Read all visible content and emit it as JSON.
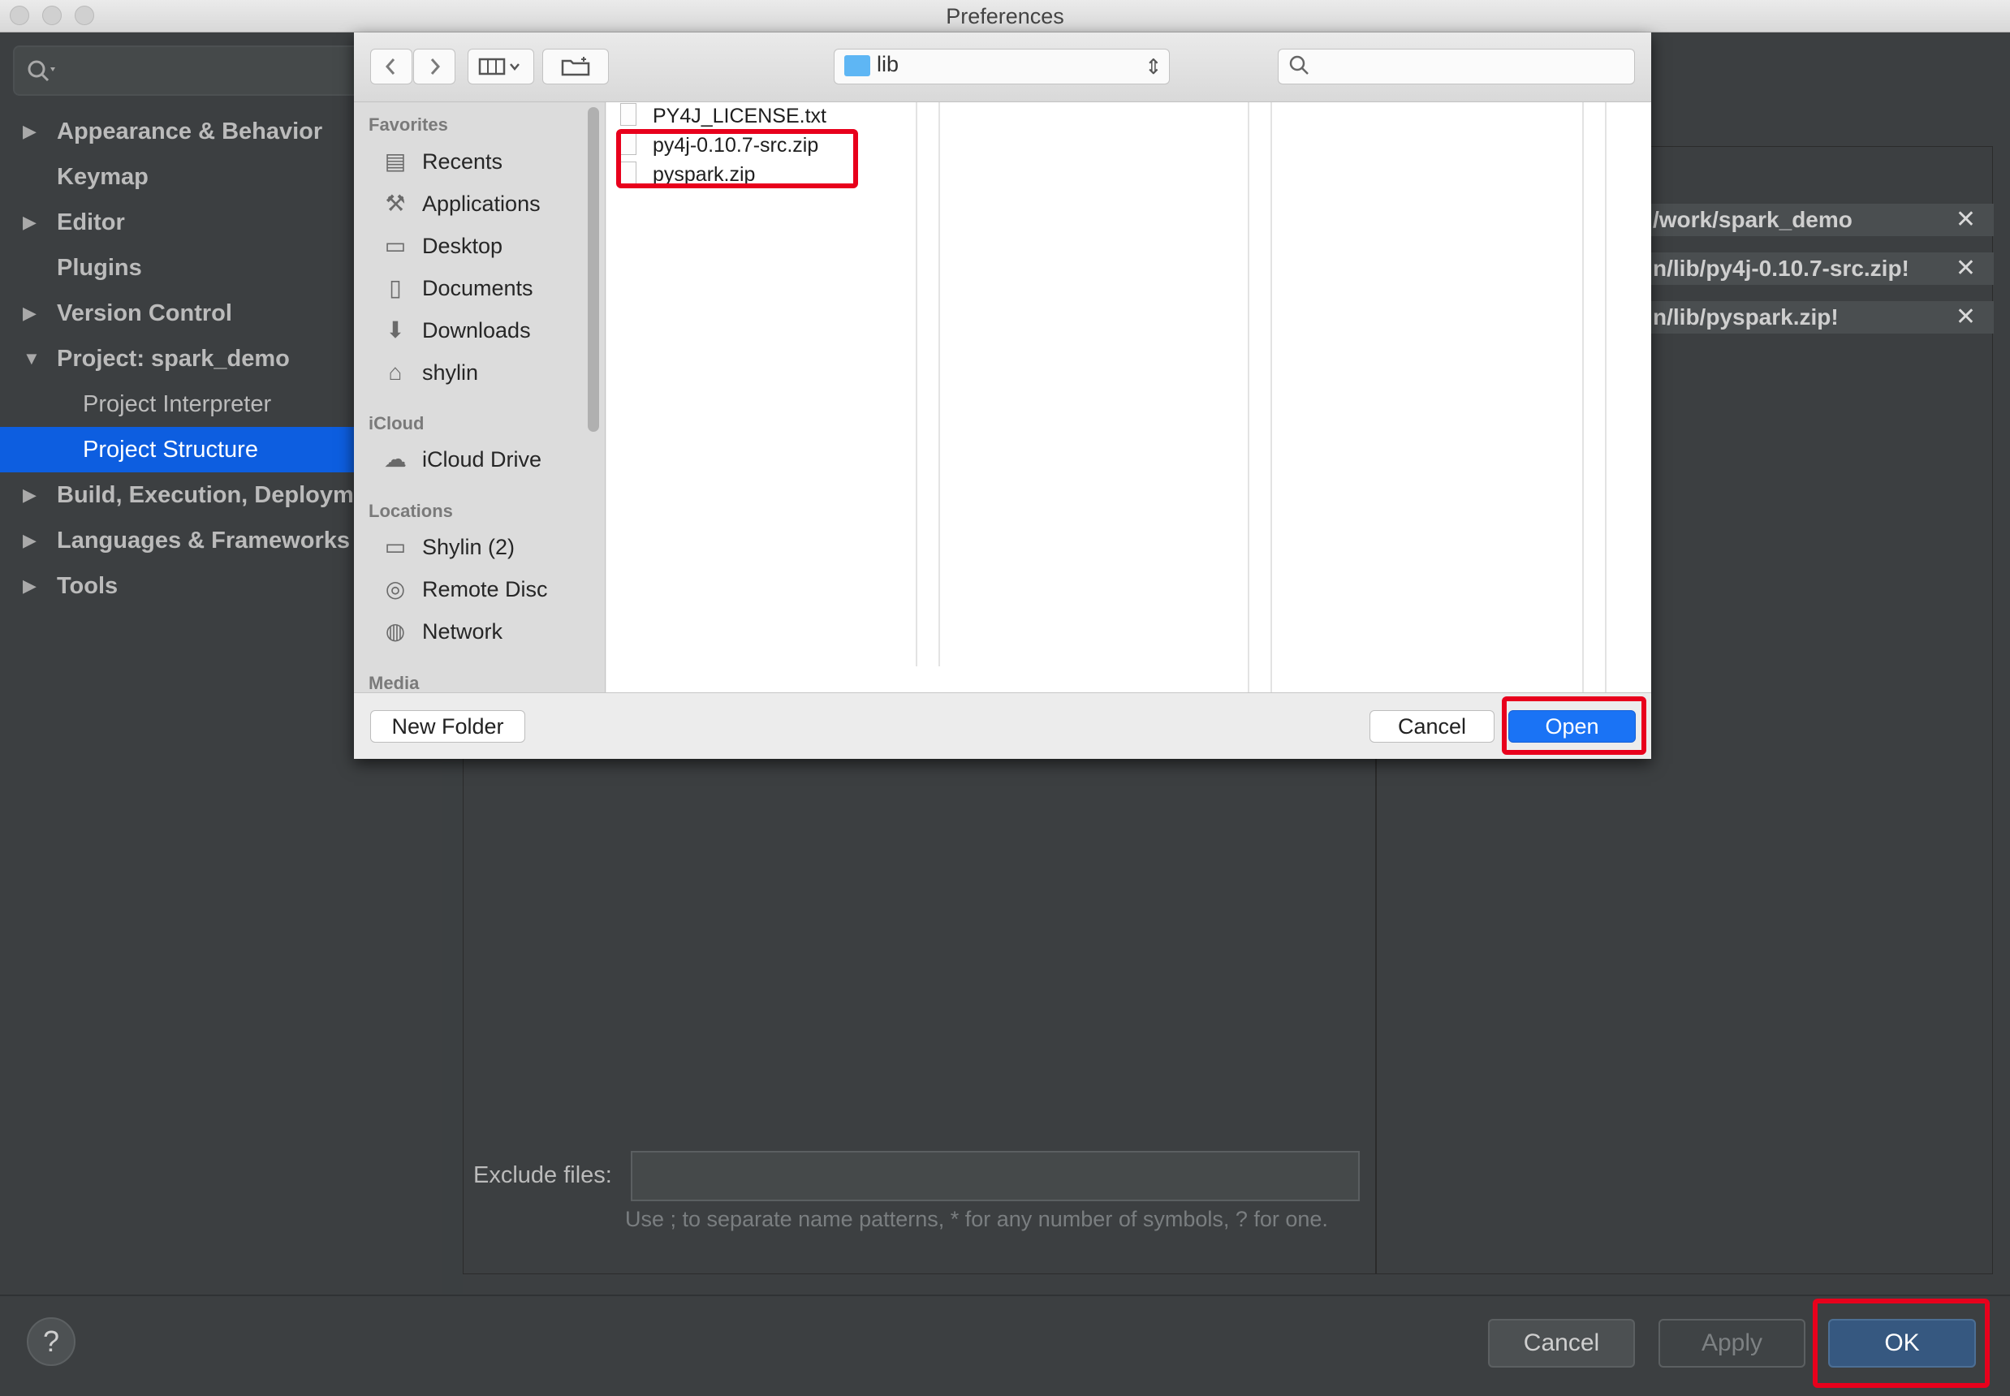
{
  "window": {
    "title": "Preferences"
  },
  "sidebar": {
    "search_placeholder": "",
    "items": [
      {
        "label": "Appearance & Behavior",
        "expandable": true
      },
      {
        "label": "Keymap",
        "expandable": false
      },
      {
        "label": "Editor",
        "expandable": true
      },
      {
        "label": "Plugins",
        "expandable": false
      },
      {
        "label": "Version Control",
        "expandable": true
      },
      {
        "label": "Project: spark_demo",
        "expandable": true,
        "expanded": true
      },
      {
        "label": "Project Interpreter",
        "expandable": false
      },
      {
        "label": "Project Structure",
        "expandable": false,
        "selected": true
      },
      {
        "label": "Build, Execution, Deploym",
        "expandable": true
      },
      {
        "label": "Languages & Frameworks",
        "expandable": true
      },
      {
        "label": "Tools",
        "expandable": true
      }
    ]
  },
  "content_roots": [
    {
      "path": "/work/spark_demo"
    },
    {
      "path": "n/lib/py4j-0.10.7-src.zip!"
    },
    {
      "path": "n/lib/pyspark.zip!"
    }
  ],
  "exclude": {
    "label": "Exclude files:",
    "value": "",
    "hint": "Use ; to separate name patterns, * for any number of symbols, ? for one."
  },
  "buttons": {
    "cancel": "Cancel",
    "apply": "Apply",
    "ok": "OK",
    "help": "?"
  },
  "file_dialog": {
    "location": "lib",
    "search_value": "",
    "sections": {
      "favorites": "Favorites",
      "icloud": "iCloud",
      "locations": "Locations",
      "media": "Media"
    },
    "favorites": [
      {
        "label": "Recents",
        "icon": "recents-icon"
      },
      {
        "label": "Applications",
        "icon": "applications-icon"
      },
      {
        "label": "Desktop",
        "icon": "desktop-icon"
      },
      {
        "label": "Documents",
        "icon": "documents-icon"
      },
      {
        "label": "Downloads",
        "icon": "downloads-icon"
      },
      {
        "label": "shylin",
        "icon": "home-icon"
      }
    ],
    "icloud": [
      {
        "label": "iCloud Drive",
        "icon": "cloud-icon"
      }
    ],
    "locations": [
      {
        "label": "Shylin (2)",
        "icon": "laptop-icon"
      },
      {
        "label": "Remote Disc",
        "icon": "disc-icon"
      },
      {
        "label": "Network",
        "icon": "network-icon"
      }
    ],
    "files": [
      {
        "name": "PY4J_LICENSE.txt"
      },
      {
        "name": "py4j-0.10.7-src.zip"
      },
      {
        "name": "pyspark.zip"
      }
    ],
    "new_folder": "New Folder",
    "cancel": "Cancel",
    "open": "Open"
  },
  "colors": {
    "ide_background": "#3c3f41",
    "selection": "#0d5ee0",
    "annotation_red": "#e8001c",
    "dialog_primary": "#1a73f5"
  }
}
